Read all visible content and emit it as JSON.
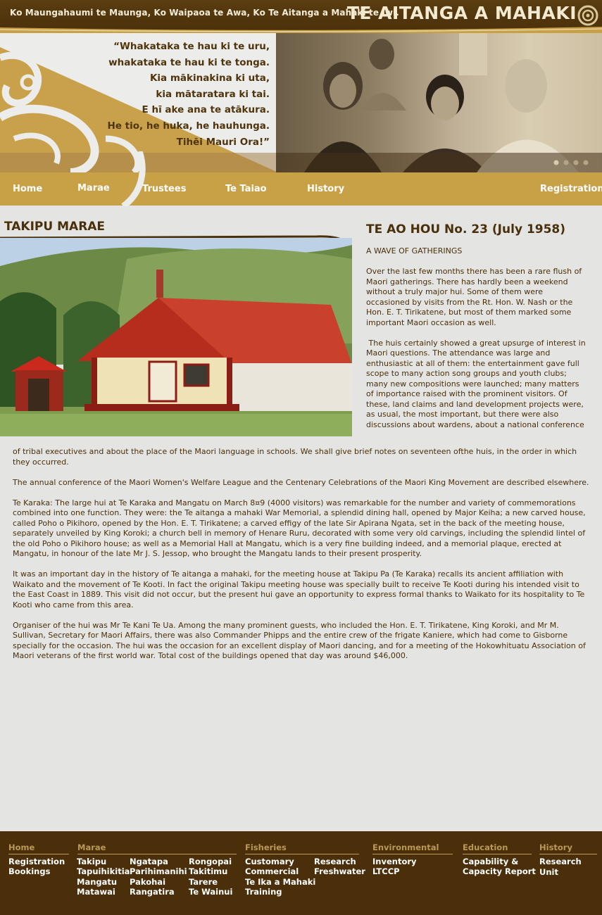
{
  "header": {
    "tagline": "Ko Maungahaumi te Maunga, Ko Waipaoa te Awa, Ko Te Aitanga a Mahaki te Iwi.",
    "logo_text": "TE AITANGA A MAHAKI",
    "poem": [
      "“Whakataka te hau ki te uru,",
      "whakataka te hau ki te tonga.",
      "Kia mākinakina ki uta,",
      "kia mātaratara ki tai.",
      "E hī ake ana te atākura.",
      "He tio, he huka, he hauhunga.",
      "Tihēi Mauri Ora!”"
    ]
  },
  "nav": {
    "home": "Home",
    "marae": "Marae",
    "trustees": "Trustees",
    "te_taiao": "Te Taiao",
    "history": "History",
    "registration": "Registration"
  },
  "left": {
    "title": "TAKIPU MARAE"
  },
  "article": {
    "title": "TE AO HOU No. 23 (July 1958)",
    "subtitle": "A WAVE OF GATHERINGS",
    "p1": "Over the last few months there has been a rare flush of Maori gatherings. There has hardly been a weekend without a truly major hui. Some of them were occasioned by visits from the Rt. Hon. W. Nash or the Hon. E. T. Tirikatene, but most of them marked some important Maori occasion as well.",
    "p2": " The huis certainly showed a great upsurge of interest in Maori questions. The attendance was large and enthusiastic at all of them: the entertainment gave full scope to many action song groups and youth clubs; many new compositions were launched; many matters of importance raised with the prominent visitors. Of these, land claims and land development projects were, as usual, the most important, but there were also discussions about wardens, about a national conference",
    "p3": "of tribal executives and about the place of the Maori language in schools. We shall give brief notes on seventeen ofthe huis, in the order in which they occurred.",
    "p4": "The annual conference of the Maori Women's Welfare League and the Centenary Celebrations of the Maori King Movement are described elsewhere.",
    "p5": "Te Karaka: The large hui at Te Karaka and Mangatu on March 8¤9 (4000 visitors) was remarkable for the number and variety of commemorations combined into one function. They were: the Te aitanga a mahaki War Memorial, a splendid dining hall, opened by Major Keiha; a new carved house, called Poho o Pikihoro, opened by the Hon. E. T. Tirikatene; a carved effigy of the late Sir Apirana Ngata, set in the back of the meeting house, separately unveiled by King Koroki; a church bell in memory of Henare Ruru, decorated with some very old carvings, including the splendid lintel of the old Poho o Pikihoro house; as well as a Memorial Hall at Mangatu, which is a very fine building indeed, and a memorial plaque, erected at Mangatu, in honour of the late Mr J. S. Jessop, who brought the Mangatu lands to their present prosperity.",
    "p6": "It was an important day in the history of Te aitanga a mahaki, for the meeting house at Takipu Pa (Te Karaka) recalls its ancient affiliation with Waikato and the movement of Te Kooti. In fact the original Takipu meeting house was specially built to receive Te Kooti during his intended visit to the East Coast in 1889. This visit did not occur, but the present hui gave an opportunity to express formal thanks to Waikato for its hospitality to Te Kooti who came from this area.",
    "p7": "Organiser of the hui was Mr Te Kani Te Ua. Among the many prominent guests, who included the Hon. E. T. Tirikatene, King Koroki, and Mr M. Sullivan, Secretary for Maori Affairs, there was also Commander Phipps and the entire crew of the frigate Kaniere, which had come to Gisborne specially for the occasion. The hui was the occasion for an excellent display of Maori dancing, and for a meeting of the Hokowhituatu Association of Maori veterans of the first world war. Total cost of the buildings opened that day was around $46,000."
  },
  "footer": {
    "home": {
      "heading": "Home",
      "links": [
        "Registration",
        "Bookings"
      ]
    },
    "marae": {
      "heading": "Marae",
      "col1": [
        "Takipu",
        "Tapuihikitia",
        "Mangatu",
        "Matawai"
      ],
      "col2": [
        "Ngatapa",
        "Parihimanihi",
        "Pakohai",
        "Rangatira"
      ],
      "col3": [
        "Rongopai",
        "Takitimu",
        "Tarere",
        "Te Wainui"
      ]
    },
    "fisheries": {
      "heading": "Fisheries",
      "col1": [
        "Customary",
        "Commercial",
        "Te Ika a Mahaki",
        "Training"
      ],
      "col2": [
        "Research",
        "Freshwater"
      ]
    },
    "environmental": {
      "heading": "Environmental",
      "links": [
        "Inventory",
        "LTCCP"
      ]
    },
    "education": {
      "heading": "Education",
      "links": [
        "Capability &",
        "Capacity Report"
      ]
    },
    "history": {
      "heading": "History",
      "links": [
        "Research Unit"
      ]
    }
  },
  "colors": {
    "brown": "#4a2f0a",
    "gold": "#c8a046",
    "background": "#e4e4e2"
  }
}
